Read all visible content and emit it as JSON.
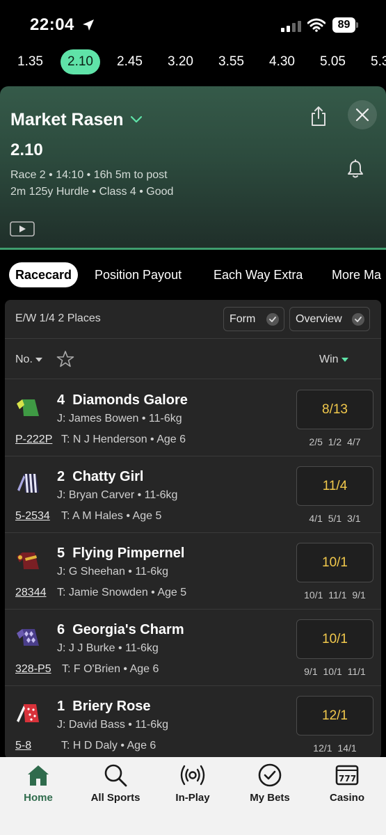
{
  "status": {
    "time": "22:04",
    "battery": "89"
  },
  "race_times": [
    "1.35",
    "2.10",
    "2.45",
    "3.20",
    "3.55",
    "4.30",
    "5.05",
    "5.3"
  ],
  "header": {
    "venue": "Market Rasen",
    "race_time": "2.10",
    "meta1": "Race 2 • 14:10 • 16h 5m to post",
    "meta2": "2m 125y Hurdle  • Class 4  • Good"
  },
  "tabs": [
    "Racecard",
    "Position Payout",
    "Each Way Extra",
    "More Ma"
  ],
  "card": {
    "ew_terms": "E/W 1/4 2 Places",
    "form_label": "Form",
    "overview_label": "Overview",
    "no_label": "No.",
    "win_label": "Win"
  },
  "runners": [
    {
      "number": "4",
      "name": "Diamonds Galore",
      "jockey": "J: James Bowen • 11-6kg",
      "form": "P-222P",
      "trainer": "T: N J Henderson • Age 6",
      "odds": "8/13",
      "history": "2/5 1/2 4/7",
      "silk": "green-yellow-icon"
    },
    {
      "number": "2",
      "name": "Chatty Girl",
      "jockey": "J: Bryan Carver • 11-6kg",
      "form": "5-2534",
      "trainer": "T: A M Hales • Age 5",
      "odds": "11/4",
      "history": "4/1 5/1 3/1",
      "silk": "purple-white-stripes-icon"
    },
    {
      "number": "5",
      "name": "Flying Pimpernel",
      "jockey": "J: G Sheehan • 11-6kg",
      "form": "28344",
      "trainer": "T: Jamie Snowden • Age 5",
      "odds": "10/1",
      "history": "10/1 11/1 9/1",
      "silk": "maroon-yellow-icon"
    },
    {
      "number": "6",
      "name": "Georgia's Charm",
      "jockey": "J: J J Burke • 11-6kg",
      "form": "328-P5",
      "trainer": "T: F O'Brien • Age 6",
      "odds": "10/1",
      "history": "9/1 10/1 11/1",
      "silk": "purple-diamonds-icon"
    },
    {
      "number": "1",
      "name": "Briery Rose",
      "jockey": "J: David Bass • 11-6kg",
      "form": "5-8",
      "trainer": "T: H D Daly • Age 6",
      "odds": "12/1",
      "history": "12/1 14/1",
      "silk": "red-white-spots-icon"
    }
  ],
  "bottom_nav": [
    {
      "label": "Home",
      "icon": "home-icon"
    },
    {
      "label": "All Sports",
      "icon": "search-icon"
    },
    {
      "label": "In-Play",
      "icon": "in-play-icon"
    },
    {
      "label": "My Bets",
      "icon": "check-circle-icon"
    },
    {
      "label": "Casino",
      "icon": "slot-machine-icon"
    }
  ],
  "colors": {
    "accent": "#5fe3a8",
    "odds": "#f2c94c",
    "home_active": "#2f6b4c"
  }
}
